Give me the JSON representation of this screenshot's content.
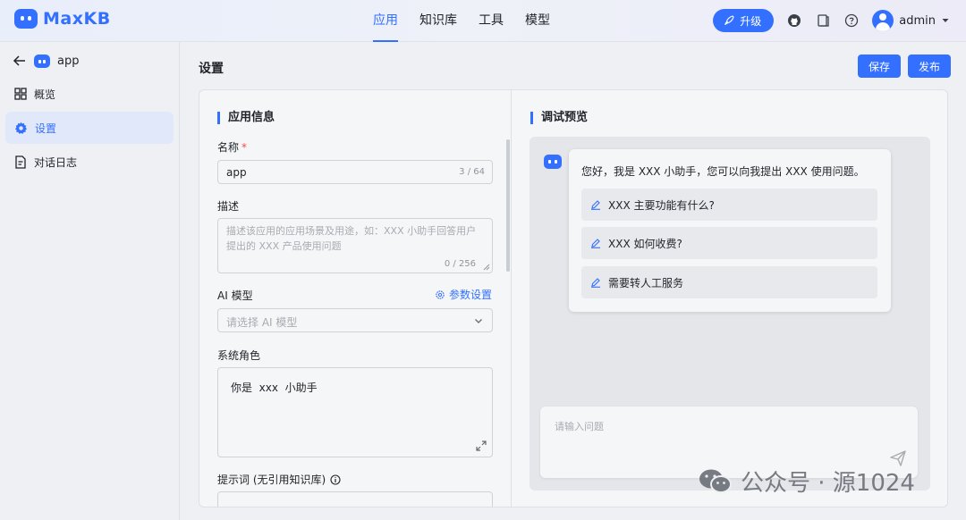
{
  "header": {
    "logo_text": "MaxKB",
    "nav": [
      {
        "label": "应用",
        "active": true
      },
      {
        "label": "知识库",
        "active": false
      },
      {
        "label": "工具",
        "active": false
      },
      {
        "label": "模型",
        "active": false
      }
    ],
    "upgrade_label": "升级",
    "user_name": "admin"
  },
  "sidebar": {
    "app_name": "app",
    "items": [
      {
        "label": "概览",
        "icon": "grid-icon"
      },
      {
        "label": "设置",
        "icon": "gear-icon",
        "active": true
      },
      {
        "label": "对话日志",
        "icon": "document-icon"
      }
    ]
  },
  "page": {
    "title": "设置",
    "save_label": "保存",
    "publish_label": "发布"
  },
  "app_info": {
    "section_title": "应用信息",
    "name_label": "名称",
    "required_mark": "*",
    "name_value": "app",
    "name_counter": "3 / 64",
    "desc_label": "描述",
    "desc_placeholder": "描述该应用的应用场景及用途，如：XXX 小助手回答用户提出的 XXX 产品使用问题",
    "desc_counter": "0 / 256",
    "model_label": "AI 模型",
    "model_params_link": "参数设置",
    "model_placeholder": "请选择 AI 模型",
    "system_role_label": "系统角色",
    "system_role_value": "你是  xxx  小助手",
    "prompt_label": "提示词 (无引用知识库)"
  },
  "preview": {
    "section_title": "调试预览",
    "greeting": "您好，我是 XXX 小助手，您可以向我提出 XXX 使用问题。",
    "suggestions": [
      "XXX 主要功能有什么?",
      "XXX 如何收费?",
      "需要转人工服务"
    ],
    "input_placeholder": "请输入问题"
  },
  "watermark": "公众号 · 源1024",
  "colors": {
    "accent": "#3370ff",
    "required": "#f54a45"
  }
}
